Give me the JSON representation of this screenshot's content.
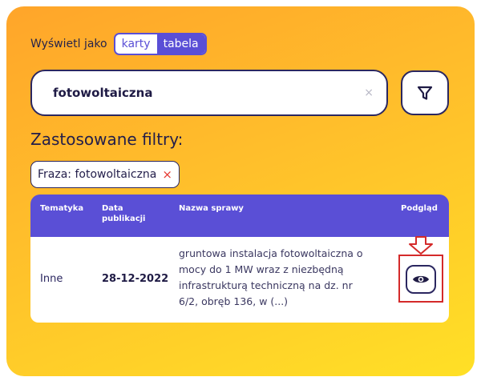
{
  "view": {
    "label": "Wyświetl jako",
    "options": [
      "karty",
      "tabela"
    ],
    "selected": "tabela"
  },
  "search": {
    "value": "fotowoltaiczna",
    "clear_symbol": "×"
  },
  "filter_button": {
    "icon": "filter-icon"
  },
  "applied_filters": {
    "title": "Zastosowane filtry:",
    "chips": [
      {
        "label": "Fraza: fotowoltaiczna",
        "remove_symbol": "×"
      }
    ]
  },
  "table": {
    "headers": {
      "topic": "Tematyka",
      "date_line1": "Data",
      "date_line2": "publikacji",
      "case_name": "Nazwa sprawy",
      "preview": "Podgląd"
    },
    "rows": [
      {
        "topic": "Inne",
        "date": "28-12-2022",
        "case_lines": [
          "gruntowa instalacja fotowoltaiczna o",
          "mocy do 1 MW wraz z niezbędną",
          "infrastrukturą techniczną na dz. nr",
          "6/2, obręb 136, w (...)"
        ],
        "preview_icon": "eye-icon"
      }
    ]
  },
  "colors": {
    "accent": "#5a4fd6",
    "dark": "#2b2760",
    "highlight": "#d42a2a",
    "gradient_start": "#ffa52a",
    "gradient_end": "#ffe026"
  }
}
